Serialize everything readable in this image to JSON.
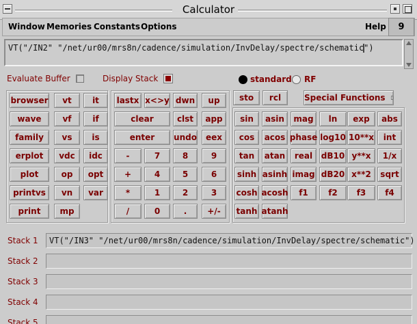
{
  "window": {
    "title": "Calculator"
  },
  "menu": {
    "items": [
      "Window",
      "Memories",
      "Constants",
      "Options"
    ],
    "help": "Help",
    "badge": "9"
  },
  "expression": {
    "value": "VT(\"/IN2\" \"/net/ur00/mrs8n/cadence/simulation/InvDelay/spectre/schematic\")"
  },
  "options": {
    "evaluate_buffer": {
      "label": "Evaluate Buffer",
      "checked": false
    },
    "display_stack": {
      "label": "Display Stack",
      "checked": true
    },
    "mode": {
      "standard": "standard",
      "rf": "RF",
      "selected": "standard"
    }
  },
  "top_buttons": {
    "sto": "sto",
    "rcl": "rcl",
    "special": "Special Functions"
  },
  "sim_buttons": [
    [
      "browser",
      "vt",
      "it"
    ],
    [
      "wave",
      "vf",
      "if"
    ],
    [
      "family",
      "vs",
      "is"
    ],
    [
      "erplot",
      "vdc",
      "idc"
    ],
    [
      "plot",
      "op",
      "opt"
    ],
    [
      "printvs",
      "vn",
      "var"
    ],
    [
      "print",
      "mp",
      ""
    ]
  ],
  "keypad": {
    "row1": [
      "lastx",
      "x<>y",
      "dwn",
      "up"
    ],
    "row2": [
      "clear",
      "clst",
      "app"
    ],
    "row3": [
      "enter",
      "undo",
      "eex"
    ],
    "digits": [
      [
        "-",
        "7",
        "8",
        "9"
      ],
      [
        "+",
        "4",
        "5",
        "6"
      ],
      [
        "*",
        "1",
        "2",
        "3"
      ],
      [
        "/",
        "0",
        ".",
        "+/-"
      ]
    ]
  },
  "functions": [
    [
      "sin",
      "asin",
      "mag",
      "ln",
      "exp",
      "abs"
    ],
    [
      "cos",
      "acos",
      "phase",
      "log10",
      "10**x",
      "int"
    ],
    [
      "tan",
      "atan",
      "real",
      "dB10",
      "y**x",
      "1/x"
    ],
    [
      "sinh",
      "asinh",
      "imag",
      "dB20",
      "x**2",
      "sqrt"
    ],
    [
      "cosh",
      "acosh",
      "f1",
      "f2",
      "f3",
      "f4"
    ],
    [
      "tanh",
      "atanh"
    ]
  ],
  "stacks": [
    {
      "label": "Stack 1",
      "value": "VT(\"/IN3\" \"/net/ur00/mrs8n/cadence/simulation/InvDelay/spectre/schematic\")"
    },
    {
      "label": "Stack 2",
      "value": ""
    },
    {
      "label": "Stack 3",
      "value": ""
    },
    {
      "label": "Stack 4",
      "value": ""
    },
    {
      "label": "Stack 5",
      "value": ""
    }
  ]
}
